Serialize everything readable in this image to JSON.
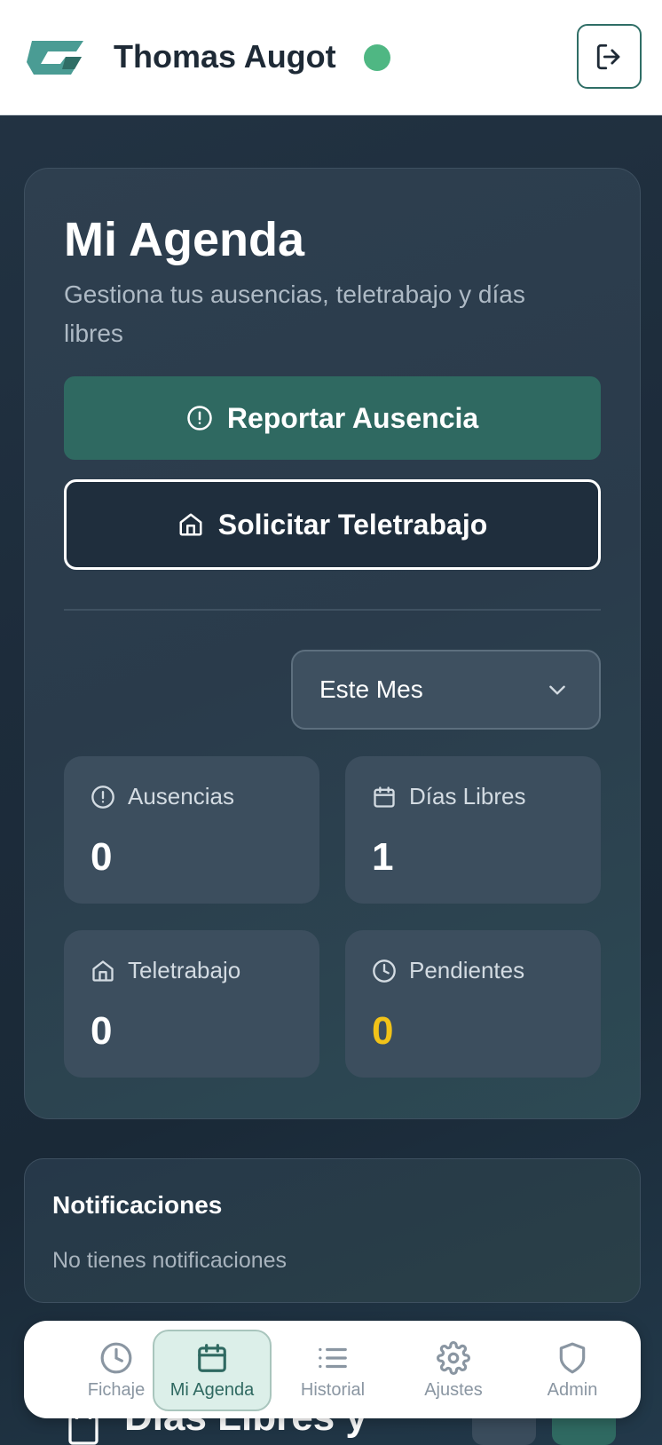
{
  "header": {
    "user_name": "Thomas Augot",
    "status_color": "#4fb783",
    "logout_icon": "logout-icon",
    "logo_icon": "brand-logo"
  },
  "agenda": {
    "title": "Mi Agenda",
    "subtitle": "Gestiona tus ausencias, teletrabajo y días libres",
    "report_button": {
      "label": "Reportar Ausencia",
      "icon": "alert-circle-icon"
    },
    "telework_button": {
      "label": "Solicitar Teletrabajo",
      "icon": "home-icon"
    },
    "period_select": {
      "value": "Este Mes",
      "icon": "chevron-down-icon"
    },
    "stats": [
      {
        "label": "Ausencias",
        "value": "0",
        "icon": "alert-circle-icon"
      },
      {
        "label": "Días Libres",
        "value": "1",
        "icon": "calendar-icon"
      },
      {
        "label": "Teletrabajo",
        "value": "0",
        "icon": "home-icon"
      },
      {
        "label": "Pendientes",
        "value": "0",
        "icon": "clock-icon",
        "color": "#f2c318"
      }
    ]
  },
  "notifications": {
    "title": "Notificaciones",
    "empty_text": "No tienes notificaciones"
  },
  "next_section": {
    "title_partial": "Días Libres y"
  },
  "bottom_nav": {
    "items": [
      {
        "label": "Fichaje",
        "icon": "clock-icon"
      },
      {
        "label": "Mi Agenda",
        "icon": "calendar-icon",
        "active": true
      },
      {
        "label": "Historial",
        "icon": "list-icon"
      },
      {
        "label": "Ajustes",
        "icon": "gear-icon"
      },
      {
        "label": "Admin",
        "icon": "shield-icon"
      }
    ]
  },
  "colors": {
    "accent": "#2f6961",
    "background": "#1d2c3b",
    "pending": "#f2c318"
  }
}
